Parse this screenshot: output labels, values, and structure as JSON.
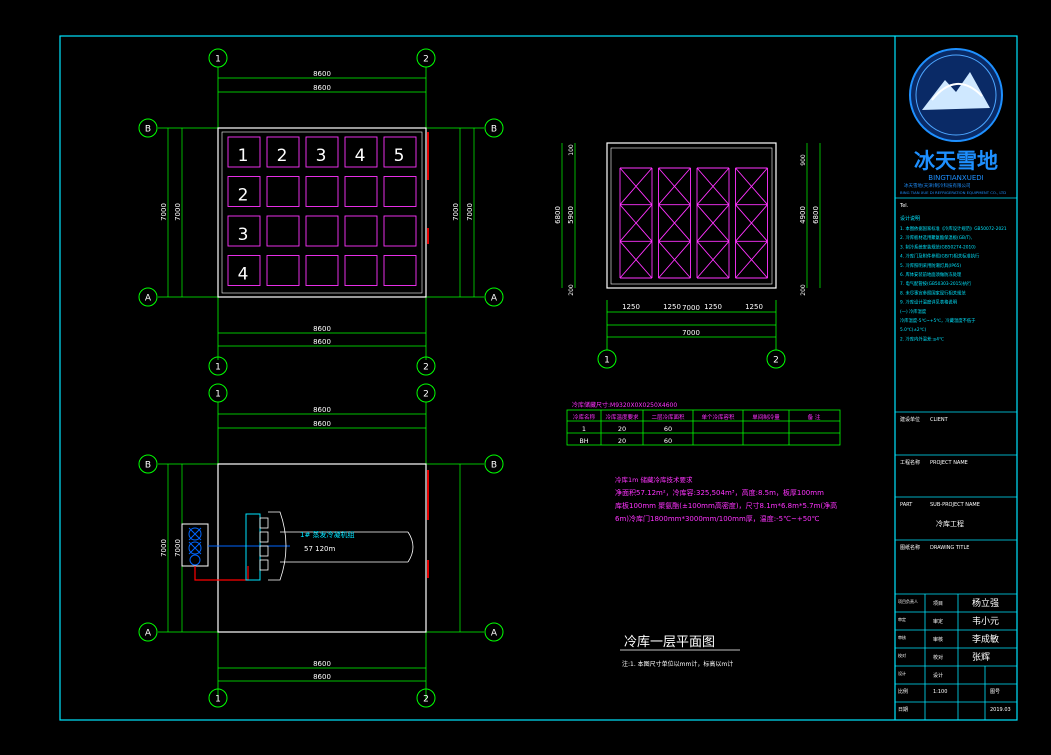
{
  "colors": {
    "background": "#000000",
    "frame": "#00e5ff",
    "grid": "#00ff00",
    "wall": "#ffffff",
    "rack": "#ff33ff",
    "door": "#ff0000",
    "pipe": "#0066ff",
    "note_magenta": "#ff33ff"
  },
  "grid_labels": {
    "a": "A",
    "b": "B",
    "one": "1",
    "two": "2"
  },
  "dims": {
    "d8600": "8600",
    "d7000": "7000",
    "d6800": "6800",
    "d5900": "5900",
    "d4900": "4900",
    "d100": "100",
    "d900": "900",
    "d300": "300",
    "d200": "200",
    "d1250": "1250"
  },
  "row_numbers": [
    "1",
    "2",
    "3",
    "4",
    "5"
  ],
  "equipment": {
    "unit_label": "1# 蒸发冷凝机组",
    "unit_spec": "57 120m"
  },
  "table": {
    "title": "冷库储藏尺寸:M9320X0X0250X4600",
    "headers": [
      "冷库名称",
      "冷库温度要求",
      "二层冷库面积",
      "单个冷库容积",
      "单间制冷量",
      "备 注"
    ],
    "rows": [
      [
        "1",
        "20",
        "60",
        "",
        "",
        ""
      ],
      [
        "BH",
        "20",
        "60",
        "",
        "",
        ""
      ]
    ]
  },
  "notes_magenta": [
    "冷库1m 储藏冷库技术要求",
    "净面积57.12m²，冷库容:325,504m³，高度:8.5m，板厚100mm",
    "库板100mm 聚氨酯(±100mm高密度)，尺寸8.1m*6.8m*5.7m(净高",
    "6m)冷库门1800mm*3000mm/100mm厚，温度:-5℃~+50℃"
  ],
  "drawing_title": "冷库一层平面图",
  "drawing_note": "注:1. 本图尺寸单位以mm计，标高以m计",
  "title_block": {
    "logo_text": "冰天雪地",
    "logo_sub": "BINGTIANXUEDI",
    "company_line1": "冰天雪地(天津)制冷科技有限公司",
    "company_line2": "BING TIAN XUE DI REFRIGERATION EQUIPMENT CO., LTD",
    "tel": "Tel.",
    "notes_heading": "设计说明",
    "notes": [
      "1. 本图依据国家标准《冷库设计规范》GB50072-2021",
      "2. 冷库板材选用聚氨酯保温板(GB/T),",
      "3. 制冷系统安装规范(GB50274-2010)",
      "4. 冷库门及附件参照(GB/T)相关标准执行",
      "5. 冷库照明采用防潮灯具(IP65)",
      "6. 库体安装前地面须做防冻处理",
      "7. 电气配管按(GB50303-2015)执行",
      "8. 未尽事宜参照国家现行相关规范",
      "9. 冷库设计温度详见表格说明",
      "(一) 冷库温度",
      "冷库温度-5℃~+5℃，冷藏温度不低于",
      "5.0℃(±2℃)",
      "2. 冷库内外温差:≤4℃"
    ],
    "client_label": "建设单位",
    "client_value": "CLIENT",
    "project_label": "工程名称",
    "project_value": "PROJECT NAME",
    "subproject_label": "PART",
    "subproject_value": "SUB-PROJECT NAME",
    "subproject_text": "冷库工程",
    "drawing_label": "图纸名称",
    "drawing_value": "DRAWING TITLE",
    "sign_rows": [
      {
        "en": "项目负责人",
        "cn": "项目",
        "sig": "杨立强"
      },
      {
        "en": "审定",
        "cn": "审定",
        "sig": "韦小元"
      },
      {
        "en": "审核",
        "cn": "审核",
        "sig": "李成敏"
      },
      {
        "en": "校对",
        "cn": "校对",
        "sig": "张辉"
      },
      {
        "en": "设计",
        "cn": "设计",
        "sig": ""
      }
    ],
    "scale_label": "比例",
    "scale_value": "1:100",
    "sheet_label": "图号",
    "sheet_value": "NO.",
    "date_label": "日期",
    "date_value": "2019.03"
  }
}
